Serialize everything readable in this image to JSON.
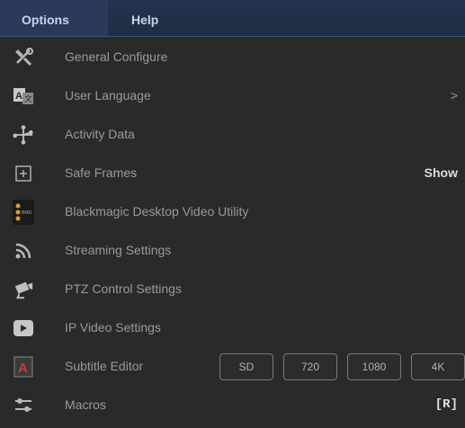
{
  "menubar": {
    "options": "Options",
    "help": "Help"
  },
  "items": [
    {
      "label": "General Configure",
      "icon": "tools-icon"
    },
    {
      "label": "User Language",
      "icon": "language-icon",
      "right": ">"
    },
    {
      "label": "Activity Data",
      "icon": "network-icon"
    },
    {
      "label": "Safe Frames",
      "icon": "frame-plus-icon",
      "right": "Show"
    },
    {
      "label": "Blackmagic Desktop Video Utility",
      "icon": "bmd-icon"
    },
    {
      "label": "Streaming Settings",
      "icon": "rss-icon"
    },
    {
      "label": "PTZ Control Settings",
      "icon": "camera-icon"
    },
    {
      "label": "IP Video Settings",
      "icon": "play-icon"
    },
    {
      "label": "Subtitle Editor",
      "icon": "subtitle-icon",
      "buttons": [
        "SD",
        "720",
        "1080",
        "4K"
      ]
    },
    {
      "label": "Macros",
      "icon": "macros-icon",
      "right": "[R]"
    }
  ],
  "colors": {
    "menubar": "#24344f",
    "background": "#2a2a2a",
    "subtitle_icon_accent": "#c83a3a"
  }
}
